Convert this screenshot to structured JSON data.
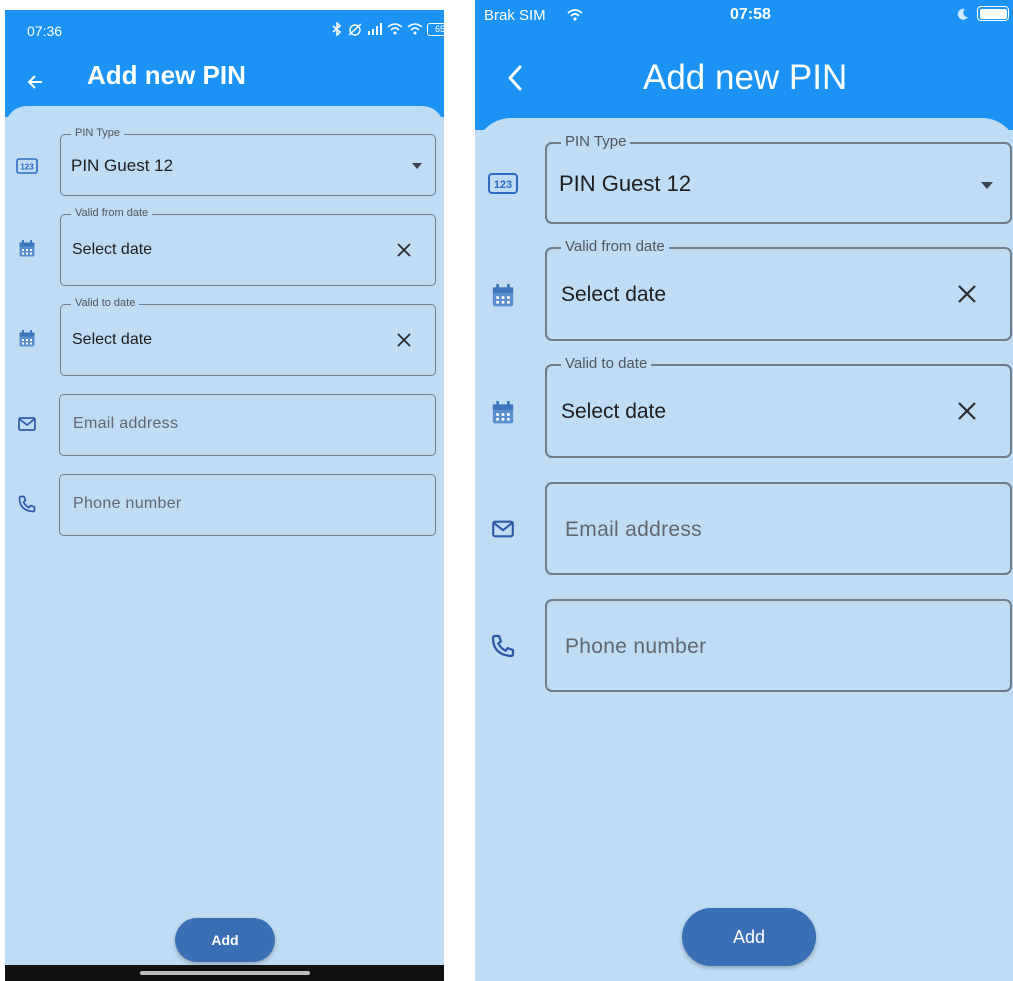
{
  "android": {
    "status": {
      "time": "07:36",
      "battery": "65"
    },
    "title": "Add new PIN",
    "pin_type": {
      "label": "PIN Type",
      "value": "PIN Guest 12"
    },
    "valid_from": {
      "label": "Valid from date",
      "value": "Select date"
    },
    "valid_to": {
      "label": "Valid to date",
      "value": "Select date"
    },
    "email": {
      "placeholder": "Email address"
    },
    "phone": {
      "placeholder": "Phone number"
    },
    "add_label": "Add"
  },
  "ios": {
    "status": {
      "carrier": "Brak SIM",
      "time": "07:58"
    },
    "title": "Add new PIN",
    "pin_type": {
      "label": "PIN Type",
      "value": "PIN Guest 12"
    },
    "valid_from": {
      "label": "Valid from date",
      "value": "Select date"
    },
    "valid_to": {
      "label": "Valid to date",
      "value": "Select date"
    },
    "email": {
      "placeholder": "Email address"
    },
    "phone": {
      "placeholder": "Phone number"
    },
    "add_label": "Add"
  },
  "colors": {
    "appbar": "#1b93f5",
    "background": "#bedcf4",
    "button": "#3a6fb5",
    "icon_blue": "#2c6cc4",
    "calendar_icon": "#5a8fcf"
  },
  "icons": {
    "pin_type": "numeric-123-icon",
    "date": "calendar-icon",
    "email": "envelope-icon",
    "phone": "phone-icon",
    "clear": "close-icon",
    "dropdown": "caret-down-icon"
  }
}
